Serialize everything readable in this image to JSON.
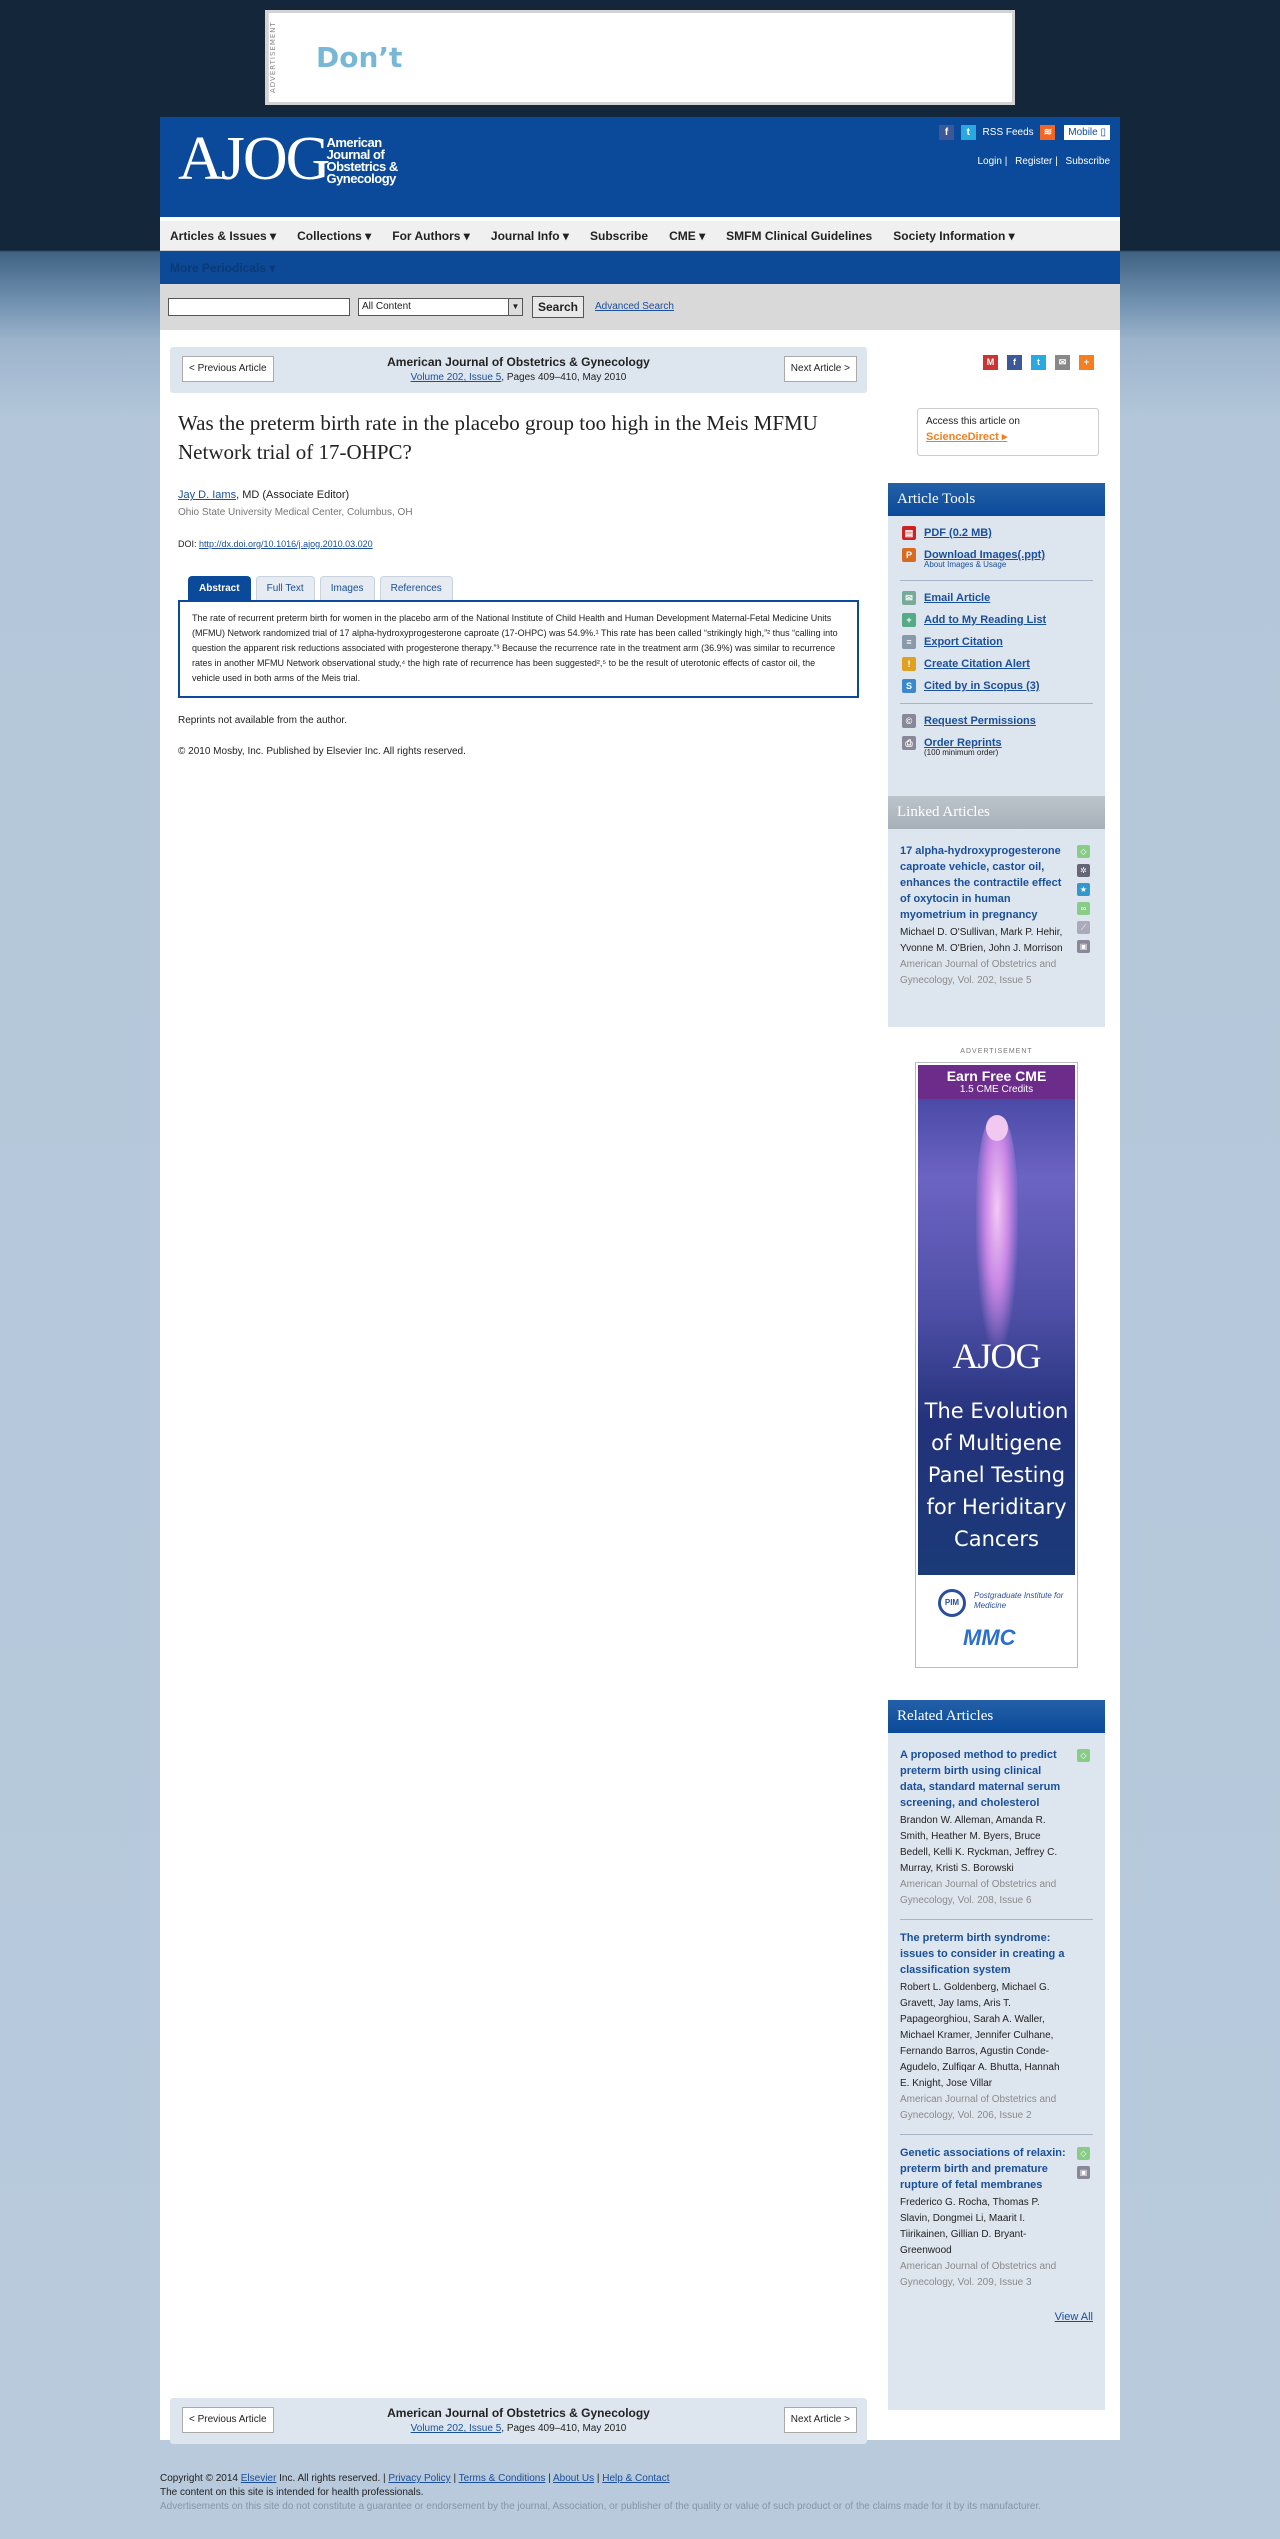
{
  "top_ad": {
    "label": "ADVERTISEMENT",
    "text": "Don’t"
  },
  "header": {
    "logo_big": "AJOG",
    "logo_small": [
      "American",
      "Journal of",
      "Obstetrics &",
      "Gynecology"
    ],
    "rss": "RSS Feeds",
    "mobile": "Mobile",
    "login": "Login",
    "register": "Register",
    "subscribe": "Subscribe"
  },
  "nav": [
    "Articles & Issues",
    "Collections",
    "For Authors",
    "Journal Info",
    "Subscribe",
    "CME",
    "SMFM Clinical Guidelines",
    "Society Information"
  ],
  "subnav": "More Periodicals",
  "search": {
    "query": "",
    "scope": "All Content",
    "button": "Search",
    "advanced": "Advanced Search"
  },
  "article_nav": {
    "prev": "< Previous Article",
    "next": "Next Article >",
    "journal": "American Journal of Obstetrics & Gynecology",
    "volume_link": "Volume 202, Issue 5",
    "pages": ", Pages 409–410, May 2010"
  },
  "access": {
    "text": "Access this article on",
    "link": "ScienceDirect"
  },
  "article": {
    "title": "Was the preterm birth rate in the placebo group too high in the Meis MFMU Network trial of 17-OHPC?",
    "author_name": "Jay D. Iams",
    "author_role": ", MD (Associate Editor)",
    "affiliation": "Ohio State University Medical Center, Columbus, OH",
    "doi_label": "DOI: ",
    "doi_link": "http://dx.doi.org/10.1016/j.ajog.2010.03.020",
    "tabs": [
      "Abstract",
      "Full Text",
      "Images",
      "References"
    ],
    "abstract": "The rate of recurrent preterm birth for women in the placebo arm of the National Institute of Child Health and Human Development Maternal-Fetal Medicine Units (MFMU) Network randomized trial of 17 alpha-hydroxyprogesterone caproate (17-OHPC) was 54.9%.¹ This rate has been called “strikingly high,”² thus “calling into question the apparent risk reductions associated with progesterone therapy.”³ Because the recurrence rate in the treatment arm (36.9%) was similar to recurrence rates in another MFMU Network observational study,⁴ the high rate of recurrence has been suggested²,⁵ to be the result of uterotonic effects of castor oil, the vehicle used in both arms of the Meis trial.",
    "reprints": "Reprints not available from the author.",
    "copyright": "© 2010 Mosby, Inc. Published by Elsevier Inc. All rights reserved."
  },
  "article_tools": {
    "title": "Article Tools",
    "items": [
      {
        "label": "PDF (0.2 MB)",
        "icon": "pdf-icon"
      },
      {
        "label": "Download Images(.ppt)",
        "icon": "ppt-icon",
        "sub": "About Images & Usage"
      },
      {
        "label": "Email Article",
        "icon": "email-icon"
      },
      {
        "label": "Add to My Reading List",
        "icon": "reading-list-icon"
      },
      {
        "label": "Export Citation",
        "icon": "export-icon"
      },
      {
        "label": "Create Citation Alert",
        "icon": "alert-icon"
      },
      {
        "label": "Cited by in Scopus (3)",
        "icon": "scopus-icon"
      },
      {
        "label": "Request Permissions",
        "icon": "permissions-icon"
      },
      {
        "label": "Order Reprints",
        "icon": "reprints-icon",
        "sub": "(100 minimum order)"
      }
    ]
  },
  "linked_articles": {
    "title": "Linked Articles",
    "items": [
      {
        "title": "17 alpha-hydroxyprogesterone caproate vehicle, castor oil, enhances the contractile effect of oxytocin in human myometrium in pregnancy",
        "authors": "Michael D. O'Sullivan, Mark P. Hehir, Yvonne M. O'Brien, John J. Morrison",
        "source": "American Journal of Obstetrics and Gynecology, Vol. 202, Issue 5"
      }
    ]
  },
  "side_ad": {
    "label": "ADVERTISEMENT",
    "earn": "Earn Free CME",
    "credits": "1.5 CME Credits",
    "logo": "AJOG",
    "message": "The Evolution of Multigene Panel Testing for Heriditary Cancers",
    "pim": "PIM",
    "pim_text": "Postgraduate Institute for Medicine",
    "mmc": "MMC"
  },
  "related_articles": {
    "title": "Related Articles",
    "items": [
      {
        "title": "A proposed method to predict preterm birth using clinical data, standard maternal serum screening, and cholesterol",
        "authors": "Brandon W. Alleman, Amanda R. Smith, Heather M. Byers, Bruce Bedell, Kelli K. Ryckman, Jeffrey C. Murray, Kristi S. Borowski",
        "source": "American Journal of Obstetrics and Gynecology, Vol. 208, Issue 6"
      },
      {
        "title": "The preterm birth syndrome: issues to consider in creating a classification system",
        "authors": "Robert L. Goldenberg, Michael G. Gravett, Jay Iams, Aris T. Papageorghiou, Sarah A. Waller, Michael Kramer, Jennifer Culhane, Fernando Barros, Agustin Conde-Agudelo, Zulfiqar A. Bhutta, Hannah E. Knight, Jose Villar",
        "source": "American Journal of Obstetrics and Gynecology, Vol. 206, Issue 2"
      },
      {
        "title": "Genetic associations of relaxin: preterm birth and premature rupture of fetal membranes",
        "authors": "Frederico G. Rocha, Thomas P. Slavin, Dongmei Li, Maarit I. Tiirikainen, Gillian D. Bryant-Greenwood",
        "source": "American Journal of Obstetrics and Gynecology, Vol. 209, Issue 3"
      }
    ],
    "view_all": "View All"
  },
  "footer": {
    "copyright_pre": "Copyright © 2014 ",
    "elsevier": "Elsevier",
    "copyright_post": " Inc. All rights reserved. | ",
    "privacy": "Privacy Policy",
    "terms": "Terms & Conditions",
    "about": "About Us",
    "help": "Help & Contact",
    "line2": "The content on this site is intended for health professionals.",
    "line3": "Advertisements on this site do not constitute a guarantee or endorsement by the journal, Association, or publisher of the quality or value of such product or of the claims made for it by its manufacturer."
  },
  "colors": {
    "header_blue": "#0b4a9a",
    "link": "#1a4f9a",
    "nav_bg": "#f0f0f0",
    "sidebar_bg": "#dde6ef"
  }
}
